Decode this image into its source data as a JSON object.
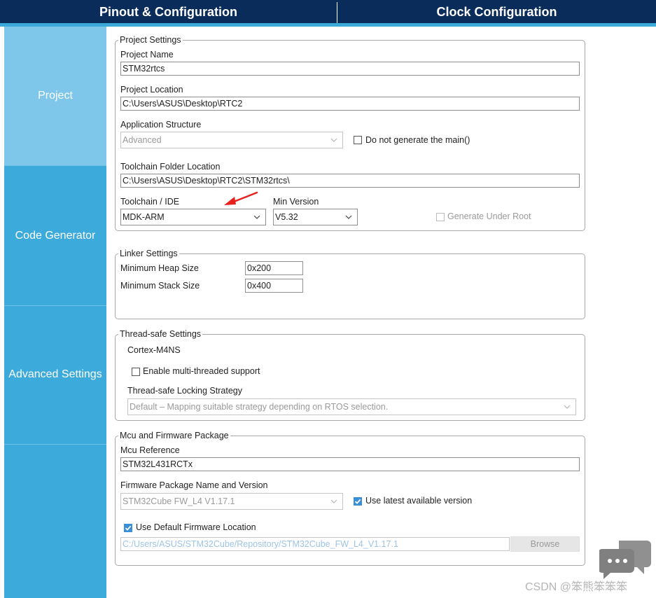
{
  "tabs": {
    "pinout": "Pinout & Configuration",
    "clock": "Clock Configuration"
  },
  "sidebar": {
    "items": [
      {
        "label": "Project"
      },
      {
        "label": "Code Generator"
      },
      {
        "label": "Advanced Settings"
      }
    ]
  },
  "project_settings": {
    "legend": "Project Settings",
    "project_name_label": "Project Name",
    "project_name_value": "STM32rtcs",
    "project_location_label": "Project Location",
    "project_location_value": "C:\\Users\\ASUS\\Desktop\\RTC2",
    "app_structure_label": "Application Structure",
    "app_structure_value": "Advanced",
    "no_main_label": "Do not generate the main()",
    "toolchain_folder_label": "Toolchain Folder Location",
    "toolchain_folder_value": "C:\\Users\\ASUS\\Desktop\\RTC2\\STM32rtcs\\",
    "toolchain_label": "Toolchain / IDE",
    "toolchain_value": "MDK-ARM",
    "min_version_label": "Min Version",
    "min_version_value": "V5.32",
    "generate_under_root_label": "Generate Under Root"
  },
  "linker_settings": {
    "legend": "Linker Settings",
    "heap_label": "Minimum Heap Size",
    "heap_value": "0x200",
    "stack_label": "Minimum Stack Size",
    "stack_value": "0x400"
  },
  "thread_safe": {
    "legend": "Thread-safe Settings",
    "core": "Cortex-M4NS",
    "enable_label": "Enable multi-threaded support",
    "strategy_label": "Thread-safe Locking Strategy",
    "strategy_value": "Default  –  Mapping suitable strategy depending on RTOS selection."
  },
  "mcu_firmware": {
    "legend": "Mcu and Firmware Package",
    "mcu_ref_label": "Mcu Reference",
    "mcu_ref_value": "STM32L431RCTx",
    "fw_label": "Firmware Package Name and Version",
    "fw_value": "STM32Cube FW_L4 V1.17.1",
    "use_latest_label": "Use latest available version",
    "use_default_label": "Use Default Firmware Location",
    "fw_path_value": "C:/Users/ASUS/STM32Cube/Repository/STM32Cube_FW_L4_V1.17.1",
    "browse_label": "Browse"
  },
  "watermark": "CSDN @笨熊笨笨笨",
  "colors": {
    "topbar": "#0a2c5a",
    "sidebar": "#3caadb",
    "sidebar_active": "#7ec7ea",
    "checkbox_on": "#3a8fd6",
    "arrow": "#e8211f"
  }
}
